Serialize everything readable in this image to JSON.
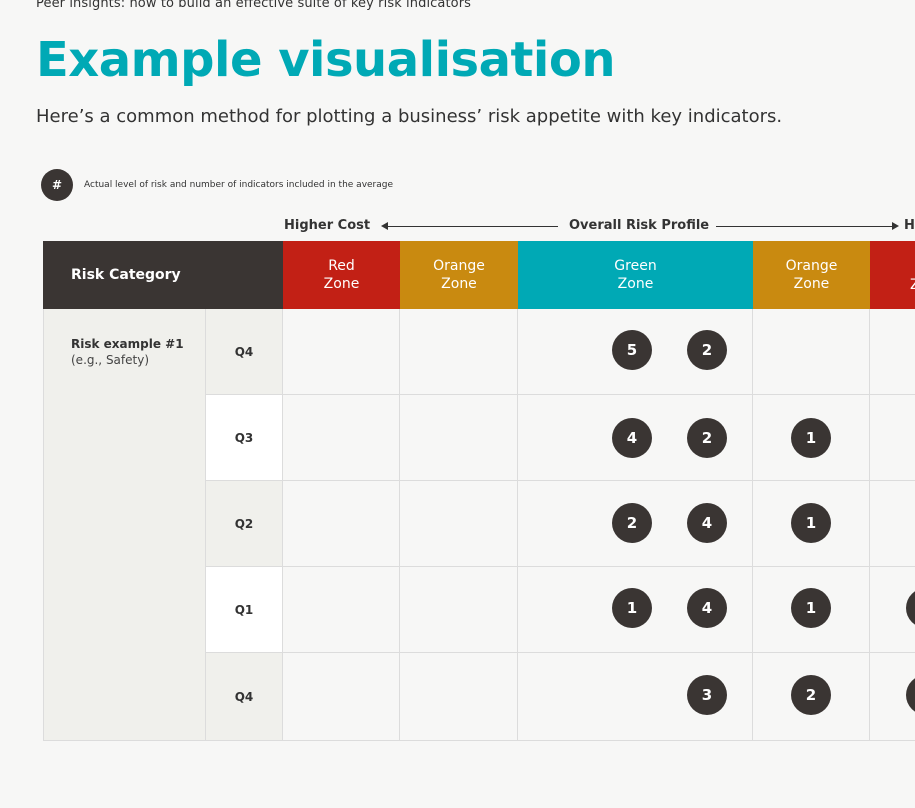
{
  "breadcrumb": "Peer insights: how to build an effective suite of key risk indicators",
  "title": "Example visualisation",
  "subtitle": "Here’s a common method for plotting a business’ risk appetite with key indicators.",
  "legend": {
    "badge": "#",
    "text": "Actual level of risk and number of indicators included in the average"
  },
  "axis": {
    "left_label": "Higher Cost",
    "center_label": "Overall Risk Profile",
    "right_label": "H"
  },
  "table": {
    "header_category": "Risk Category",
    "zones": [
      "Red\nZone",
      "Orange\nZone",
      "Green\nZone",
      "Orange\nZone",
      "Z"
    ],
    "zone_colors": {
      "red": "#c22015",
      "orange": "#c98a10",
      "green": "#00a9b5",
      "header_dark": "#3a3533"
    },
    "category": {
      "name": "Risk example #1",
      "example": "(e.g., Safety)"
    },
    "rows": [
      {
        "quarter": "Q4",
        "counts": {
          "green_left": "5",
          "green_right": "2"
        }
      },
      {
        "quarter": "Q3",
        "counts": {
          "green_left": "4",
          "green_right": "2",
          "orange_right": "1"
        }
      },
      {
        "quarter": "Q2",
        "counts": {
          "green_left": "2",
          "green_right": "4",
          "orange_right": "1"
        }
      },
      {
        "quarter": "Q1",
        "counts": {
          "green_left": "1",
          "green_right": "4",
          "orange_right": "1",
          "red_right": ""
        }
      },
      {
        "quarter": "Q4",
        "counts": {
          "green_right": "3",
          "orange_right": "2",
          "red_right": ""
        }
      }
    ]
  }
}
